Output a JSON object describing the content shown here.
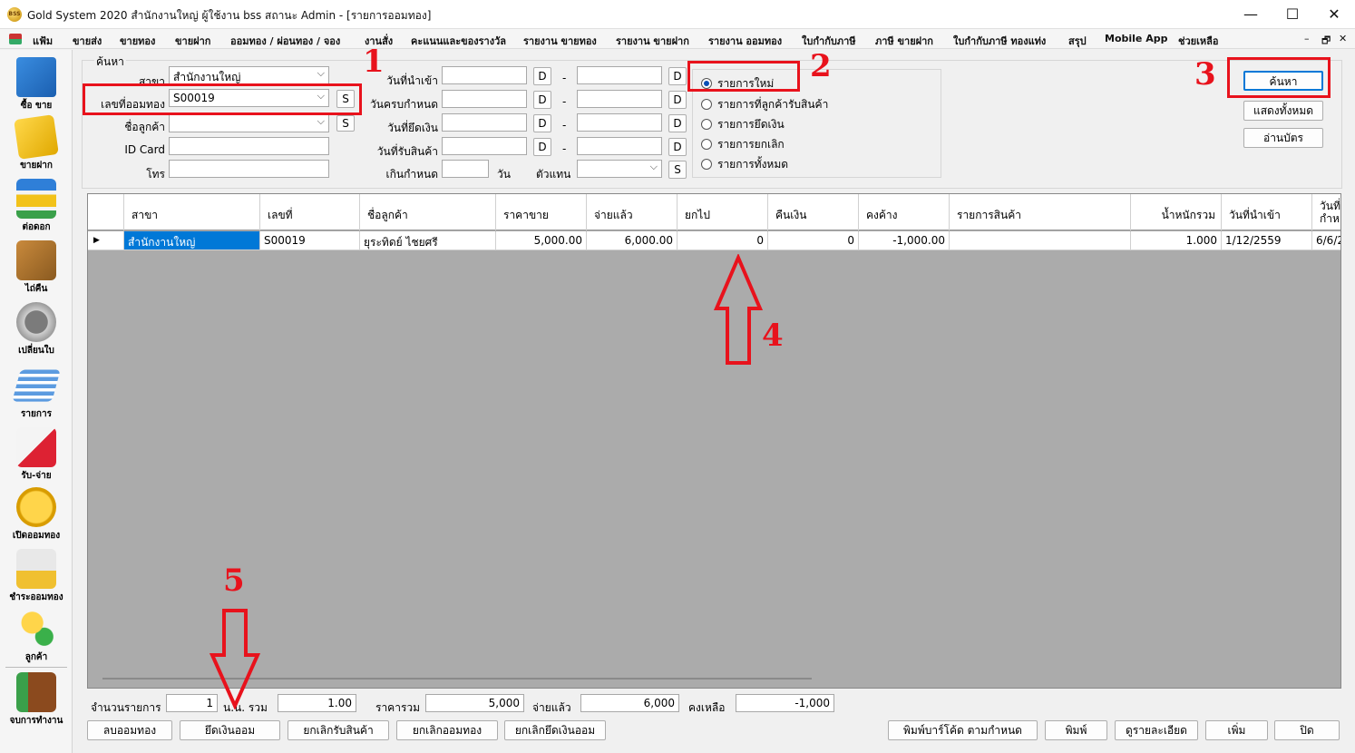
{
  "window": {
    "title": "Gold System 2020  สำนักงานใหญ่ ผู้ใช้งาน bss สถานะ Admin - [รายการออมทอง]",
    "app_icon_text": "BSS",
    "minimize": "—",
    "maximize": "☐",
    "close": "✕"
  },
  "menu": [
    "แฟ้ม",
    "ขายส่ง",
    "ขายทอง",
    "ขายฝาก",
    "ออมทอง / ผ่อนทอง / จอง",
    "งานสั่ง",
    "คะแนนและของรางวัล",
    "รายงาน ขายทอง",
    "รายงาน ขายฝาก",
    "รายงาน ออมทอง",
    "ใบกำกับภาษี",
    "ภาษี ขายฝาก",
    "ใบกำกับภาษี ทองแท่ง",
    "สรุป",
    "Mobile App",
    "ช่วยเหลือ"
  ],
  "mdi_controls": {
    "min": "–",
    "restore": "🗗",
    "close": "✕"
  },
  "toolbar": [
    {
      "label": "ซื้อ ขาย",
      "icon": "cart-icon"
    },
    {
      "label": "ขายฝาก",
      "icon": "clipboard-icon"
    },
    {
      "label": "ต่อดอก",
      "icon": "transfer-icon"
    },
    {
      "label": "ไถ่คืน",
      "icon": "box-return-icon"
    },
    {
      "label": "เปลี่ยนใบ",
      "icon": "refresh-icon"
    },
    {
      "label": "รายการ",
      "icon": "layers-icon"
    },
    {
      "label": "รับ-จ่าย",
      "icon": "receipt-icon"
    },
    {
      "label": "เปิดออมทอง",
      "icon": "coin-icon"
    },
    {
      "label": "ชำระออมทอง",
      "icon": "savings-icon"
    },
    {
      "label": "ลูกค้า",
      "icon": "user-add-icon"
    },
    {
      "label": "จบการทำงาน",
      "icon": "exit-door-icon"
    }
  ],
  "search": {
    "group_label": "ค้นหา",
    "branch_label": "สาขา",
    "branch_value": "สำนักงานใหญ่",
    "saving_no_label": "เลขที่ออมทอง",
    "saving_no_value": "S00019",
    "customer_label": "ชื่อลูกค้า",
    "customer_value": "",
    "idcard_label": "ID Card",
    "idcard_value": "",
    "phone_label": "โทร",
    "phone_value": "",
    "s_button": "S",
    "d_button": "D",
    "dash": "-",
    "date_in_label": "วันที่นำเข้า",
    "date_due_label": "วันครบกำหนด",
    "date_seize_label": "วันที่ยึดเงิน",
    "date_receive_label": "วันที่รับสินค้า",
    "overdue_label": "เกินกำหนด",
    "days_label": "วัน",
    "agent_label": "ตัวแทน"
  },
  "radios": [
    {
      "label": "รายการใหม่",
      "checked": true
    },
    {
      "label": "รายการที่ลูกค้ารับสินค้า",
      "checked": false
    },
    {
      "label": "รายการยึดเงิน",
      "checked": false
    },
    {
      "label": "รายการยกเลิก",
      "checked": false
    },
    {
      "label": "รายการทั้งหมด",
      "checked": false
    }
  ],
  "right_buttons": {
    "search": "ค้นหา",
    "show_all": "แสดงทั้งหมด",
    "read_card": "อ่านบัตร"
  },
  "annotations": [
    "1",
    "2",
    "3",
    "4",
    "5"
  ],
  "grid": {
    "columns": [
      "สาขา",
      "เลขที่",
      "ชื่อลูกค้า",
      "ราคาขาย",
      "จ่ายแล้ว",
      "ยกไป",
      "คืนเงิน",
      "คงค้าง",
      "รายการสินค้า",
      "น้ำหนักรวม",
      "วันที่นำเข้า",
      "วันที่ กำห"
    ],
    "row": {
      "marker": "▶",
      "branch": "สำนักงานใหญ่",
      "no": "S00019",
      "customer": "ยุระทิดย์ ไชยศรี",
      "price": "5,000.00",
      "paid": "6,000.00",
      "carried": "0",
      "refund": "0",
      "outstanding": "-1,000.00",
      "items": "",
      "weight": "1.000",
      "date_in": "1/12/2559",
      "date_due": "6/6/2"
    }
  },
  "summary": {
    "count_label": "จำนวนรายการ",
    "count_value": "1",
    "weight_label": "น.น. รวม",
    "weight_value": "1.00",
    "total_label": "ราคารวม",
    "total_value": "5,000",
    "paid_label": "จ่ายแล้ว",
    "paid_value": "6,000",
    "remain_label": "คงเหลือ",
    "remain_value": "-1,000"
  },
  "bottom_buttons": {
    "delete": "ลบออมทอง",
    "seize": "ยึดเงินออม",
    "cancel_receive": "ยกเลิกรับสินค้า",
    "cancel_saving": "ยกเลิกออมทอง",
    "cancel_seize": "ยกเลิกยึดเงินออม",
    "print_barcode": "พิมพ์บาร์โค้ด ตามกำหนด",
    "print": "พิมพ์",
    "details": "ดูรายละเอียด",
    "add": "เพิ่ม",
    "close": "ปิด"
  },
  "colors": {
    "annotation_red": "#e8121c",
    "selection_blue": "#0078d7",
    "grid_bg": "#ababab"
  }
}
